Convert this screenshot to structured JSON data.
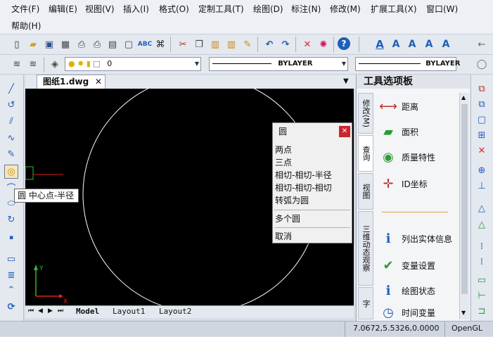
{
  "menubar": {
    "items": [
      "文件(F)",
      "编辑(E)",
      "视图(V)",
      "插入(I)",
      "格式(O)",
      "定制工具(T)",
      "绘图(D)",
      "标注(N)",
      "修改(M)",
      "扩展工具(X)",
      "窗口(W)",
      "帮助(H)"
    ]
  },
  "toolbar2": {
    "layer_value": "0",
    "linetype_value": "BYLAYER",
    "lineweight_value": "BYLAYER"
  },
  "document": {
    "tab_label": "图纸1.dwg",
    "layout_tabs": [
      "Model",
      "Layout1",
      "Layout2"
    ]
  },
  "tooltip": {
    "text": "圆 中心点-半径"
  },
  "context_menu": {
    "title": "圆",
    "group1": [
      "两点",
      "三点",
      "相切-相切-半径",
      "相切-相切-相切",
      "转弧为圆"
    ],
    "group2": [
      "多个圆"
    ],
    "group3": [
      "取消"
    ]
  },
  "ucs": {
    "x_label": "X",
    "y_label": "Y"
  },
  "palette": {
    "title": "工具选项板",
    "vertical_tabs": [
      "修改(M)",
      "查询",
      "视图",
      "三维动态观察",
      "字"
    ],
    "tools": [
      {
        "label": "距离",
        "icon": "ruler-distance-icon"
      },
      {
        "label": "面积",
        "icon": "area-icon"
      },
      {
        "label": "质量特性",
        "icon": "mass-properties-icon"
      },
      {
        "label": "ID坐标",
        "icon": "id-point-icon"
      },
      {
        "label": "列出实体信息",
        "icon": "list-info-icon"
      },
      {
        "label": "变量设置",
        "icon": "variable-settings-icon"
      },
      {
        "label": "绘图状态",
        "icon": "drawing-status-icon"
      },
      {
        "label": "时间变量",
        "icon": "time-icon"
      }
    ]
  },
  "status": {
    "coordinates": "7.0672,5.5326,0.0000",
    "renderer": "OpenGL"
  },
  "colors": {
    "canvas_bg": "#000000",
    "circle": "#ffffff",
    "close_button": "#c8262e",
    "accent_blue": "#1f5fb8"
  }
}
